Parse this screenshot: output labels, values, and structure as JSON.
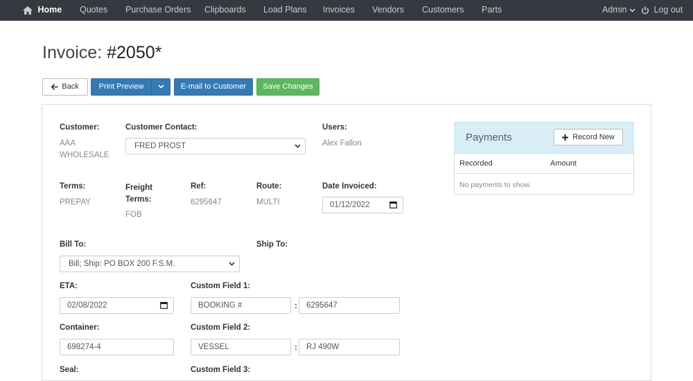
{
  "nav": {
    "home": "Home",
    "items": [
      "Quotes",
      "Purchase Orders",
      "Clipboards",
      "Load Plans",
      "Invoices",
      "Vendors",
      "Customers",
      "Parts"
    ],
    "admin": "Admin",
    "logout": "Log out"
  },
  "page": {
    "title_prefix": "Invoice:",
    "title_number": "#2050*"
  },
  "toolbar": {
    "back": "Back",
    "print_preview": "Print Preview",
    "email": "E-mail to Customer",
    "save": "Save Changes"
  },
  "form": {
    "customer_label": "Customer:",
    "customer_value_line1": "AAA",
    "customer_value_line2": "WHOLESALE",
    "contact_label": "Customer Contact:",
    "contact_value": "FRED PROST",
    "users_label": "Users:",
    "users_value": "Alex Fallon",
    "terms_label": "Terms:",
    "terms_value": "PREPAY",
    "freight_label_line1": "Freight",
    "freight_label_line2": "Terms:",
    "freight_value": "FOB",
    "ref_label": "Ref:",
    "ref_value": "6295647",
    "route_label": "Route:",
    "route_value": "MULTI",
    "date_invoiced_label": "Date Invoiced:",
    "date_invoiced_value": "01/12/2022",
    "bill_to_label": "Bill To:",
    "bill_to_value": "Bill; Ship: PO BOX 200 F.S.M.",
    "ship_to_label": "Ship To:",
    "eta_label": "ETA:",
    "eta_value": "02/08/2022",
    "custom1_label": "Custom Field 1:",
    "custom1_key": "BOOKING #",
    "custom1_value": "6295647",
    "container_label": "Container:",
    "container_value": "698274-4",
    "custom2_label": "Custom Field 2:",
    "custom2_key": "VESSEL",
    "custom2_value": "RJ 490W",
    "seal_label": "Seal:",
    "custom3_label": "Custom Field 3:",
    "colon": ":"
  },
  "payments": {
    "title": "Payments",
    "record_new": "Record New",
    "col_recorded": "Recorded",
    "col_amount": "Amount",
    "empty": "No payments to show."
  },
  "colors": {
    "navbar": "#343a40",
    "primary": "#337ab7",
    "success": "#5cb85c",
    "payments_header": "#d9edf7"
  }
}
